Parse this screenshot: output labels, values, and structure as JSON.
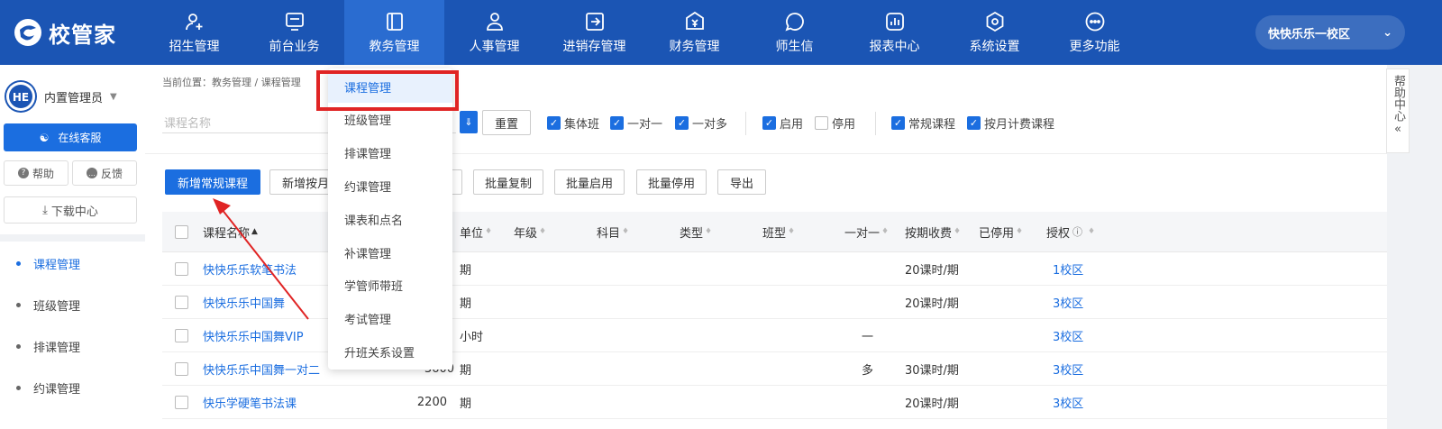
{
  "app": {
    "logo_text": "校管家",
    "campus": "快快乐乐一校区"
  },
  "nav": [
    {
      "label": "招生管理",
      "icon": "user-add-icon"
    },
    {
      "label": "前台业务",
      "icon": "monitor-icon"
    },
    {
      "label": "教务管理",
      "icon": "book-icon"
    },
    {
      "label": "人事管理",
      "icon": "person-icon"
    },
    {
      "label": "进销存管理",
      "icon": "export-icon"
    },
    {
      "label": "财务管理",
      "icon": "yen-icon"
    },
    {
      "label": "师生信",
      "icon": "chat-icon"
    },
    {
      "label": "报表中心",
      "icon": "report-icon"
    },
    {
      "label": "系统设置",
      "icon": "settings-icon"
    },
    {
      "label": "更多功能",
      "icon": "more-icon"
    }
  ],
  "sidebar": {
    "user_name": "内置管理员",
    "online_service": "在线客服",
    "help": "帮助",
    "feedback": "反馈",
    "download": "下载中心",
    "items": [
      "课程管理",
      "班级管理",
      "排课管理",
      "约课管理"
    ]
  },
  "breadcrumb": "当前位置：教务管理 / 课程管理",
  "filter": {
    "placeholder": "课程名称",
    "reset": "重置",
    "checks": [
      {
        "label": "集体班",
        "on": true
      },
      {
        "label": "一对一",
        "on": true
      },
      {
        "label": "一对多",
        "on": true
      },
      {
        "label": "启用",
        "on": true
      },
      {
        "label": "停用",
        "on": false
      },
      {
        "label": "常规课程",
        "on": true
      },
      {
        "label": "按月计费课程",
        "on": true
      }
    ]
  },
  "toolbar": {
    "add_regular": "新增常规课程",
    "add_monthly": "新增按月",
    "batch_copy": "批量复制",
    "batch_enable": "批量启用",
    "batch_disable": "批量停用",
    "export": "导出"
  },
  "table": {
    "headers": [
      "课程名称",
      "单位",
      "年级",
      "科目",
      "类型",
      "班型",
      "一对一",
      "按期收费",
      "已停用",
      "授权"
    ],
    "rows": [
      {
        "name": "快快乐乐软笔书法",
        "price": "",
        "unit": "期",
        "one2one": "",
        "charge": "20课时/期",
        "auth": "1校区"
      },
      {
        "name": "快快乐乐中国舞",
        "price": "",
        "unit": "期",
        "one2one": "",
        "charge": "20课时/期",
        "auth": "3校区"
      },
      {
        "name": "快快乐乐中国舞VIP",
        "price": "",
        "unit": "小时",
        "one2one": "一",
        "charge": "",
        "auth": "3校区"
      },
      {
        "name": "快快乐乐中国舞一对二",
        "price": "3600",
        "unit": "期",
        "one2one": "多",
        "charge": "30课时/期",
        "auth": "3校区"
      },
      {
        "name": "快乐学硬笔书法课",
        "price": "2200",
        "unit": "期",
        "one2one": "",
        "charge": "20课时/期",
        "auth": "3校区"
      }
    ]
  },
  "dropdown": [
    "课程管理",
    "班级管理",
    "排课管理",
    "约课管理",
    "课表和点名",
    "补课管理",
    "学管师带班",
    "考试管理",
    "升班关系设置"
  ],
  "help_center": "帮助中心"
}
